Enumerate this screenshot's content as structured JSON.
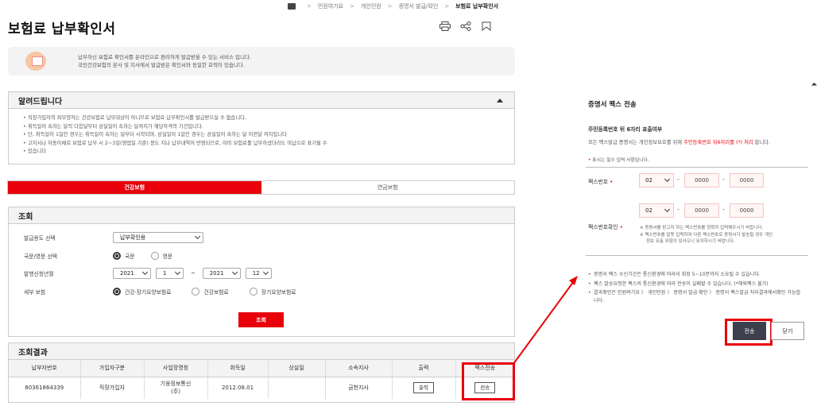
{
  "breadcrumb": [
    "민원여기요",
    "개인민원",
    "증명서 발급/확인",
    "보험료 납부확인서"
  ],
  "page": {
    "title": "보험료 납부확인서"
  },
  "toolbar": {
    "icons": [
      "print-icon",
      "share-icon",
      "bookmark-icon"
    ]
  },
  "info": {
    "line1": "납부하신 보험료 확인서를 온라인으로 편리하게 발급받을 수 있는 서비스 입니다.",
    "line2": "국민건강보험의 본사 및 지사에서 발급받은 확인서와 동일한 효력이 있습니다."
  },
  "notice": {
    "title": "알려드립니다",
    "items": [
      "직장가입자의 피부양자는 건강보험료 납부대상이 아니므로 보험료 납부확인서를 발급받으실 수 없습니다.",
      "취득일이 속하는 달의 다음달부터 상실일이 속하는 달까지가 해당자격의 기간입니다.",
      "단, 취득일이 1일인 경우는 취득일이 속하는 달부터 시작되며, 상실일이 1일인 경우는 상실일이 속하는 달 이전달 까지입니다",
      "고지서나 자동이체로 보험료 납부 시 2~3일(영업일 기준) 정도 지나 납부내역이 반영되므로, 이미 보험료를 납부하셨더라도 미납으로 표기될 수",
      "있습니다"
    ]
  },
  "tabs": [
    {
      "label": "건강보험",
      "active": true
    },
    {
      "label": "연금보험",
      "active": false
    }
  ],
  "query": {
    "title": "조회",
    "purpose": {
      "label": "발급용도 선택",
      "value": "납부확인용"
    },
    "language": {
      "label": "국문/영문 선택",
      "options": [
        "국문",
        "영문"
      ],
      "selected": "국문"
    },
    "period": {
      "label": "발행신청년월",
      "from_year": "2021",
      "from_month": "1",
      "tilde": "~",
      "to_year": "2021",
      "to_month": "12"
    },
    "detail": {
      "label": "세부 보험",
      "options": [
        "건강·장기요양보험료",
        "건강보험료",
        "장기요양보험료"
      ],
      "selected": "건강·장기요양보험료"
    },
    "submit": "조회"
  },
  "results": {
    "title": "조회결과",
    "columns": [
      "납부자번호",
      "가입자구분",
      "사업장명칭",
      "취득일",
      "상실일",
      "소속지사",
      "출력",
      "팩스전송"
    ],
    "rows": [
      {
        "payer_no": "80361864339",
        "type": "직장가입자",
        "company_line1": "기웅정보통신",
        "company_line2": "(주)",
        "acquired": "2012.08.01",
        "lost": "",
        "branch": "금천지사",
        "print_btn": "출력",
        "fax_btn": "전송"
      }
    ]
  },
  "modal": {
    "title": "증명서 팩스 전송",
    "subtitle": "주민등록번호 뒤 6자리 표출여부",
    "desc_prefix": "모든 팩스발급 증명서는 개인정보보호를 위해 ",
    "desc_red": "주민등록번호 뒤6자리를 (*) 처리",
    "desc_suffix": " 합니다.",
    "required_mark": "•",
    "required_text": " 표시는 필수 입력 사항입니다.",
    "fax_label": "팩스번호",
    "fax_confirm_label": "팩스번호확인",
    "star": "•",
    "fax": {
      "area": "02",
      "mid": "0000",
      "last": "0000",
      "dash": "-"
    },
    "fax_confirm": {
      "area": "02",
      "mid": "0000",
      "last": "0000"
    },
    "notes": [
      "※ 증명서를 받고자 하는 팩스번호를 정확히 입력해주시기 바랍니다.",
      "※ 팩스번호를 잘못 입력하여 다른 팩스번호로 증명서가 발송될 경우 개인",
      "정보 유출 위험이 있사오니 유의하시기 바랍니다."
    ],
    "bullets": [
      "증명서 팩스 수신기간은 통신환경에 따라서 최장 5~10분까지 소요될 수 있습니다.",
      "팩스 발송요청한 팩스의 통신환경에 따라 전송이 실패할 수 있습니다. (*해외팩스 불가)",
      "결과확인은 민원여기요 〉 개인민원 〉 증명서 발급·확인 〉 증명서 팩스발급 처리결과에서확인 가능합니다."
    ],
    "send": "전송",
    "close": "닫기"
  },
  "colors": {
    "accent": "#e8000b",
    "modal_send_bg": "#3d3f4d"
  }
}
